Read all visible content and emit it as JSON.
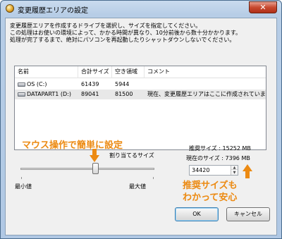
{
  "window": {
    "title": "変更履歴エリアの設定",
    "close_glyph": "✕"
  },
  "description": [
    "変更履歴エリアを作成するドライブを選択し、サイズを指定してください。",
    "この処理はお使いの環境によって、かかる時間が異なり、10分前後から数十分かかります。",
    "処理が完了するまで、絶対にパソコンを再起動したりシャットダウンしないでください。"
  ],
  "list": {
    "columns": [
      "名前",
      "合計サイズ",
      "空き領域",
      "コメント"
    ],
    "rows": [
      {
        "name": "OS (C:)",
        "total": "61439",
        "free": "5944",
        "comment": "",
        "icon": "drive-icon",
        "selected": false
      },
      {
        "name": "DATAPART1 (D:)",
        "total": "89041",
        "free": "81500",
        "comment": "現在、変更履歴エリアはここに作成されています。",
        "icon": "drive-icon",
        "selected": true
      }
    ]
  },
  "callouts": {
    "mouse": "マウス操作で簡単に設定",
    "recommended_line1": "推奨サイズも",
    "recommended_line2": "わかって安心",
    "color": "#ec8a12"
  },
  "slider": {
    "label": "割り当てるサイズ",
    "min_label": "最小値",
    "max_label": "最大値",
    "value_fraction": 0.57
  },
  "stats": {
    "recommended": "推奨サイズ : 15252 MB",
    "current": "現在のサイズ : 7396 MB"
  },
  "spin": {
    "value": "34420"
  },
  "buttons": {
    "ok": "OK",
    "cancel": "キャンセル"
  }
}
